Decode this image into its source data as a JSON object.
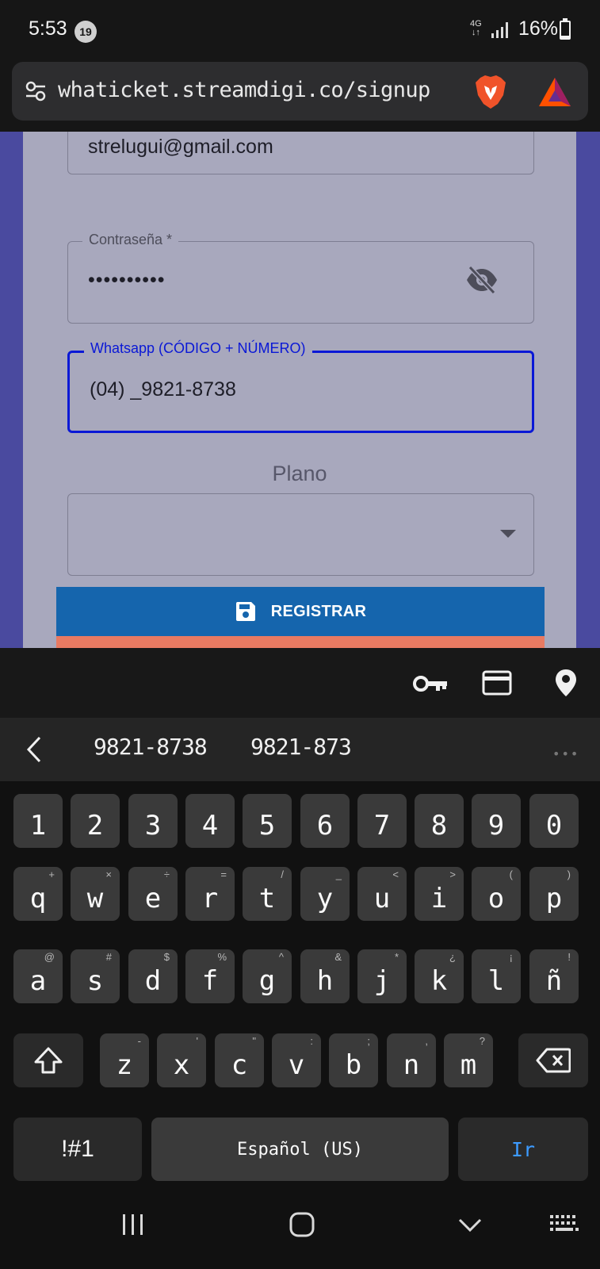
{
  "status_bar": {
    "time": "5:53",
    "notification_count": "19",
    "network_type": "4G",
    "battery": "16%",
    "battery_level": 0.16
  },
  "browser": {
    "url": "whaticket.streamdigi.co/signup"
  },
  "form": {
    "email_value": "strelugui@gmail.com",
    "password_label": "Contraseña *",
    "password_value": "••••••••••",
    "whatsapp_label": "Whatsapp (CÓDIGO + NÚMERO)",
    "whatsapp_value": "(04) _9821-8738",
    "plan_label": "Plano",
    "plan_value": "",
    "register_label": "REGISTRAR"
  },
  "colors": {
    "page_background": "#4a4a9f",
    "card_background": "#a8a8bd",
    "focused_outline": "#0a18d6",
    "register_button": "#1565ad",
    "keyboard_background": "#111111"
  },
  "autofill_icons": [
    "key-icon",
    "credit-card-icon",
    "location-pin-icon"
  ],
  "keyboard": {
    "suggestions": [
      "9821-8738",
      "9821-873"
    ],
    "number_row": [
      "1",
      "2",
      "3",
      "4",
      "5",
      "6",
      "7",
      "8",
      "9",
      "0"
    ],
    "row1": [
      {
        "key": "q",
        "hint": "+"
      },
      {
        "key": "w",
        "hint": "×"
      },
      {
        "key": "e",
        "hint": "÷"
      },
      {
        "key": "r",
        "hint": "="
      },
      {
        "key": "t",
        "hint": "/"
      },
      {
        "key": "y",
        "hint": "_"
      },
      {
        "key": "u",
        "hint": "<"
      },
      {
        "key": "i",
        "hint": ">"
      },
      {
        "key": "o",
        "hint": "("
      },
      {
        "key": "p",
        "hint": ")"
      }
    ],
    "row2": [
      {
        "key": "a",
        "hint": "@"
      },
      {
        "key": "s",
        "hint": "#"
      },
      {
        "key": "d",
        "hint": "$"
      },
      {
        "key": "f",
        "hint": "%"
      },
      {
        "key": "g",
        "hint": "^"
      },
      {
        "key": "h",
        "hint": "&"
      },
      {
        "key": "j",
        "hint": "*"
      },
      {
        "key": "k",
        "hint": "¿"
      },
      {
        "key": "l",
        "hint": "¡"
      },
      {
        "key": "ñ",
        "hint": "!"
      }
    ],
    "row3": [
      {
        "key": "z",
        "hint": "-"
      },
      {
        "key": "x",
        "hint": "'"
      },
      {
        "key": "c",
        "hint": "\""
      },
      {
        "key": "v",
        "hint": ":"
      },
      {
        "key": "b",
        "hint": ";"
      },
      {
        "key": "n",
        "hint": ","
      },
      {
        "key": "m",
        "hint": "?"
      }
    ],
    "symbols_label": "!#1",
    "space_label": "Español (US)",
    "go_label": "Ir"
  }
}
